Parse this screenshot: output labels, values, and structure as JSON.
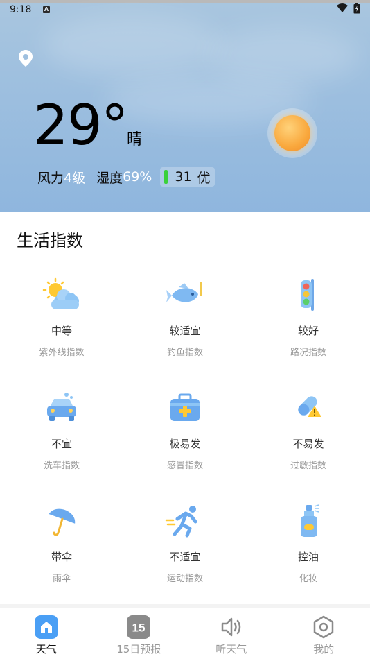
{
  "status": {
    "time": "9:18",
    "a_badge": "A"
  },
  "current": {
    "temperature": "29°",
    "condition": "晴",
    "wind_label": "风力",
    "wind_value": "4级",
    "humidity_label": "湿度",
    "humidity_value": "69%",
    "aqi_value": "31",
    "aqi_level": "优"
  },
  "life_index": {
    "title": "生活指数",
    "items": [
      {
        "level": "中等",
        "name": "紫外线指数",
        "icon": "sun-cloud-icon"
      },
      {
        "level": "较适宜",
        "name": "钓鱼指数",
        "icon": "fish-icon"
      },
      {
        "level": "较好",
        "name": "路况指数",
        "icon": "traffic-light-icon"
      },
      {
        "level": "不宜",
        "name": "洗车指数",
        "icon": "car-wash-icon"
      },
      {
        "level": "极易发",
        "name": "感冒指数",
        "icon": "medkit-icon"
      },
      {
        "level": "不易发",
        "name": "过敏指数",
        "icon": "pill-warning-icon"
      },
      {
        "level": "带伞",
        "name": "雨伞",
        "icon": "umbrella-icon"
      },
      {
        "level": "不适宜",
        "name": "运动指数",
        "icon": "runner-icon"
      },
      {
        "level": "控油",
        "name": "化妆",
        "icon": "spray-bottle-icon"
      }
    ]
  },
  "nav": {
    "items": [
      {
        "label": "天气",
        "icon": "home-icon",
        "active": true
      },
      {
        "label": "15日预报",
        "icon": "calendar-15-icon",
        "badge": "15"
      },
      {
        "label": "听天气",
        "icon": "speaker-icon"
      },
      {
        "label": "我的",
        "icon": "hexagon-settings-icon"
      }
    ]
  },
  "colors": {
    "accent": "#4a9ff5",
    "hero_top": "#a9c6df",
    "hero_bottom": "#8fb6de",
    "aqi_good": "#3ad13a"
  }
}
